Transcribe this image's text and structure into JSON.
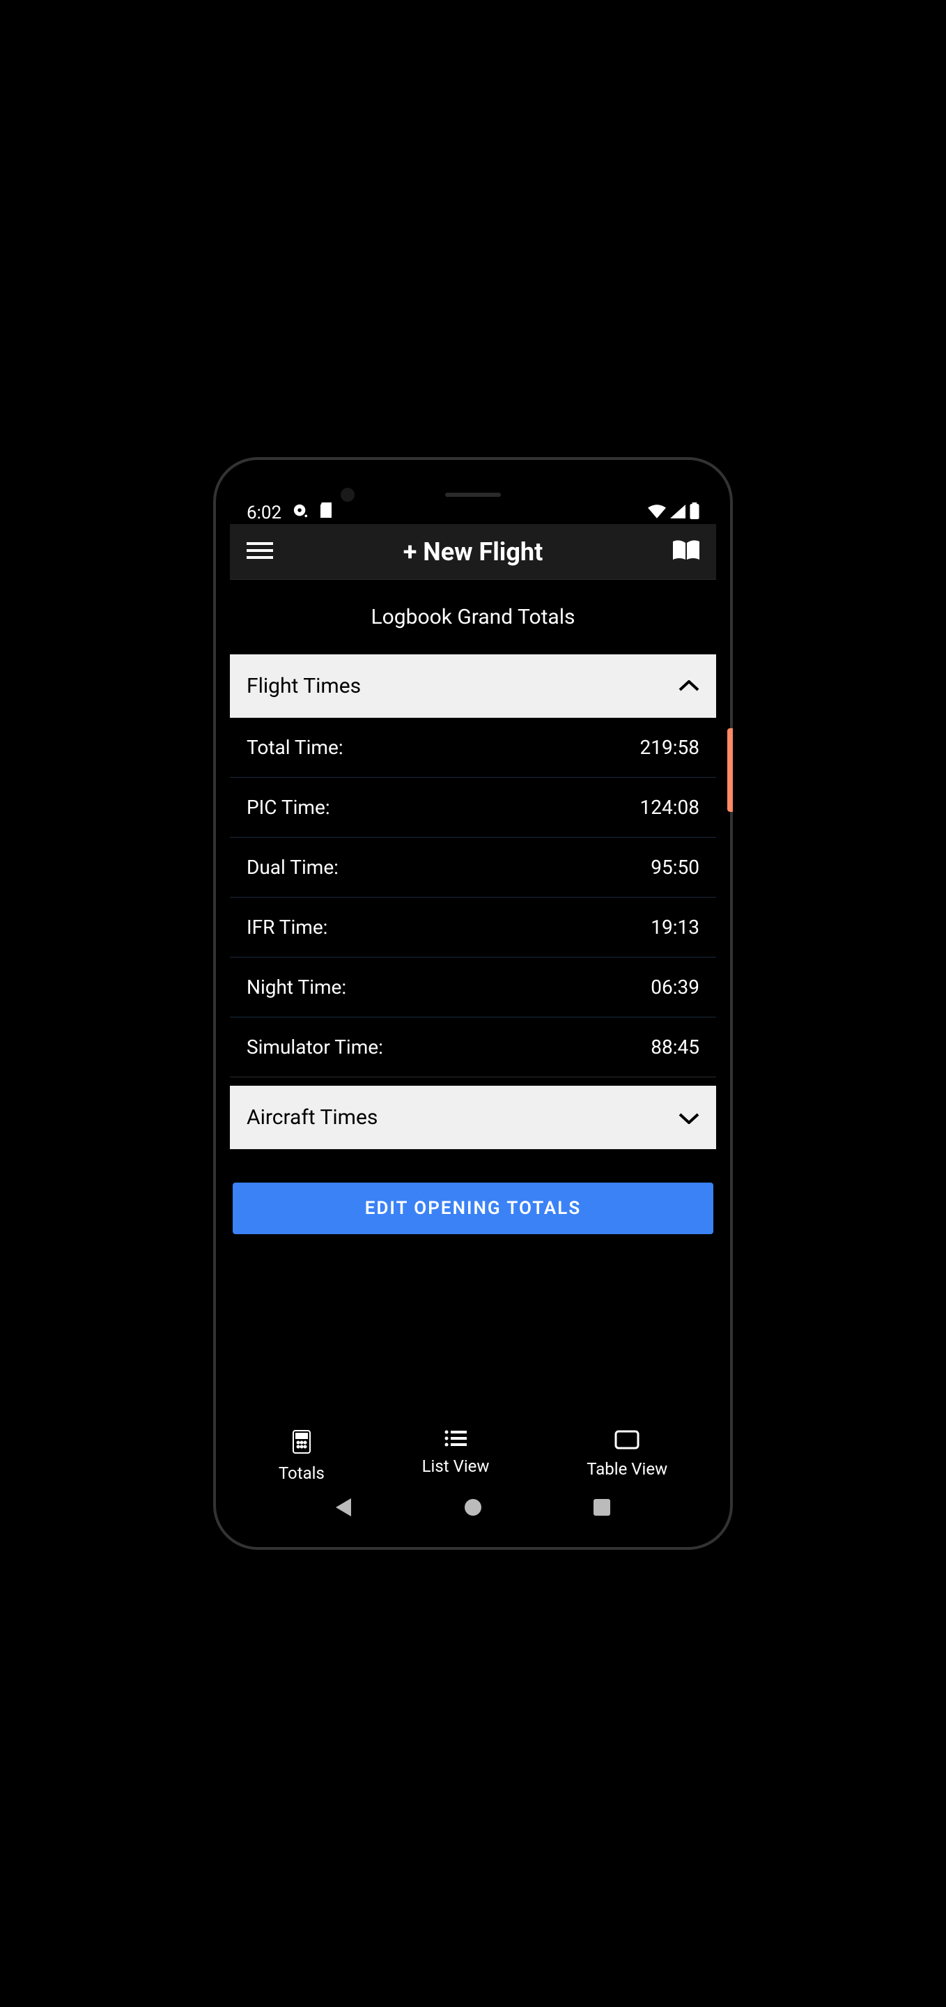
{
  "status_bar": {
    "time": "6:02"
  },
  "header": {
    "title": "+ New Flight"
  },
  "page_title": "Logbook Grand Totals",
  "sections": {
    "flight_times": {
      "label": "Flight Times",
      "expanded": true,
      "rows": [
        {
          "label": "Total Time:",
          "value": "219:58"
        },
        {
          "label": "PIC Time:",
          "value": "124:08"
        },
        {
          "label": "Dual Time:",
          "value": "95:50"
        },
        {
          "label": "IFR Time:",
          "value": "19:13"
        },
        {
          "label": "Night Time:",
          "value": "06:39"
        },
        {
          "label": "Simulator Time:",
          "value": "88:45"
        }
      ]
    },
    "aircraft_times": {
      "label": "Aircraft Times",
      "expanded": false
    }
  },
  "edit_button": "EDIT OPENING TOTALS",
  "tabs": [
    {
      "label": "Totals",
      "icon": "calculator"
    },
    {
      "label": "List View",
      "icon": "list"
    },
    {
      "label": "Table View",
      "icon": "table"
    }
  ]
}
